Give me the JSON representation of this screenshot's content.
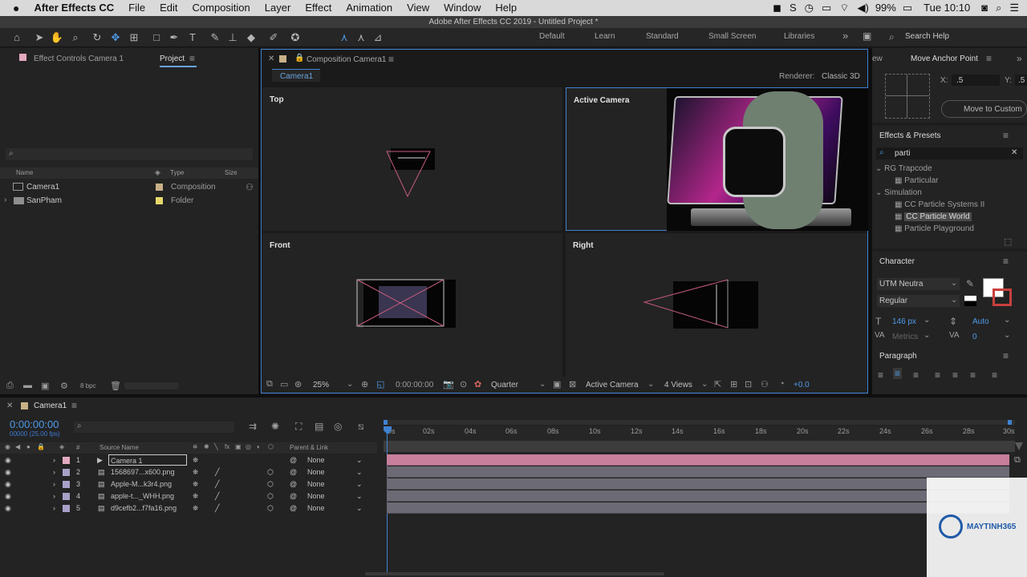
{
  "menubar": {
    "apple": "",
    "app": "After Effects CC",
    "items": [
      "File",
      "Edit",
      "Composition",
      "Layer",
      "Effect",
      "Animation",
      "View",
      "Window",
      "Help"
    ],
    "battery": "99%",
    "clock": "Tue 10:10"
  },
  "window_title": "Adobe After Effects CC 2019 - Untitled Project *",
  "workspaces": [
    "Default",
    "Learn",
    "Standard",
    "Small Screen",
    "Libraries"
  ],
  "search_help": "Search Help",
  "left_panel": {
    "tab_effect_controls": "Effect Controls Camera 1",
    "tab_project": "Project",
    "col_name": "Name",
    "col_type": "Type",
    "col_size": "Size",
    "items": [
      {
        "name": "Camera1",
        "type": "Composition"
      },
      {
        "name": "SanPham",
        "type": "Folder"
      }
    ],
    "bpc": "8 bpc"
  },
  "comp": {
    "tab": "Composition Camera1",
    "sub_tab": "Camera1",
    "renderer_label": "Renderer:",
    "renderer": "Classic 3D",
    "views": {
      "top": "Top",
      "active": "Active Camera",
      "front": "Front",
      "right": "Right"
    },
    "zoom": "25%",
    "timecode": "0:00:00:00",
    "resolution": "Quarter",
    "camera": "Active Camera",
    "view_layout": "4 Views",
    "exposure": "+0.0"
  },
  "right_panel": {
    "tab_ew": "ew",
    "tab_anchor": "Move Anchor Point",
    "x_label": "X:",
    "x_value": ".5",
    "y_label": "Y:",
    "y_value": ".5",
    "move_custom": "Move to Custom",
    "effects_title": "Effects & Presets",
    "search": "parti",
    "groups": [
      {
        "name": "RG Trapcode",
        "items": [
          "Particular"
        ]
      },
      {
        "name": "Simulation",
        "items": [
          "CC Particle Systems II",
          "CC Particle World",
          "Particle Playground"
        ]
      }
    ],
    "character_title": "Character",
    "font": "UTM Neutra",
    "style": "Regular",
    "size": "146 px",
    "leading": "Auto",
    "kerning": "Metrics",
    "tracking": "0",
    "paragraph_title": "Paragraph"
  },
  "timeline": {
    "tab": "Camera1",
    "timecode": "0:00:00:00",
    "fps": "00000 (25.00 fps)",
    "col_num": "#",
    "col_source": "Source Name",
    "col_parent": "Parent & Link",
    "ticks": [
      "0s",
      "02s",
      "04s",
      "06s",
      "08s",
      "10s",
      "12s",
      "14s",
      "16s",
      "18s",
      "20s",
      "22s",
      "24s",
      "26s",
      "28s",
      "30s"
    ],
    "layers": [
      {
        "num": "1",
        "name": "Camera 1",
        "parent": "None",
        "color": "#e3a9c0"
      },
      {
        "num": "2",
        "name": "1568697...x600.png",
        "parent": "None",
        "color": "#a9a0c8"
      },
      {
        "num": "3",
        "name": "Apple-M...k3r4.png",
        "parent": "None",
        "color": "#a9a0c8"
      },
      {
        "num": "4",
        "name": "apple-t..._WHH.png",
        "parent": "None",
        "color": "#a9a0c8"
      },
      {
        "num": "5",
        "name": "d9cefb2...f7fa16.png",
        "parent": "None",
        "color": "#a9a0c8"
      }
    ]
  },
  "watermark": {
    "brand": "MAYTINH365"
  }
}
